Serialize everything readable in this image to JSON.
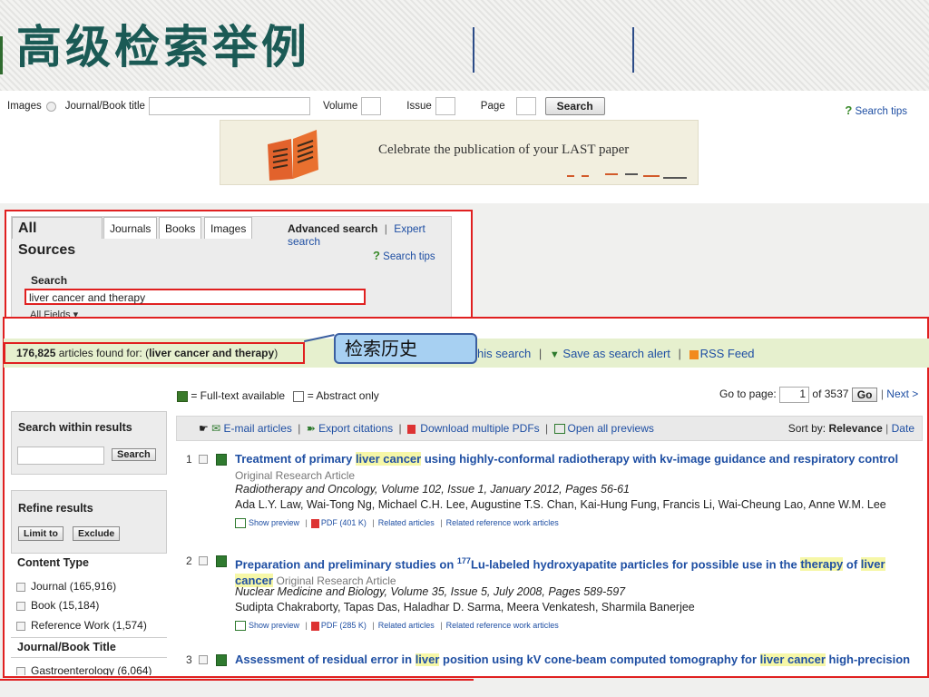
{
  "slide_title": "高级检索举例",
  "top_search": {
    "images_label": "Images",
    "journal_label": "Journal/Book title",
    "volume_label": "Volume",
    "issue_label": "Issue",
    "page_label": "Page",
    "search_button": "Search",
    "search_tips": "Search tips"
  },
  "banner": {
    "text": "Celebrate the publication of your LAST paper"
  },
  "advanced": {
    "tabs": [
      "All Sources",
      "Journals",
      "Books",
      "Images"
    ],
    "advanced_search": "Advanced search",
    "expert_search": "Expert search",
    "search_tips": "Search tips",
    "search_label": "Search",
    "query": "liver cancer and therapy",
    "field_select": "All Fields"
  },
  "results_header": {
    "count": "176,825",
    "found_text": " articles found for: (",
    "query": "liver cancer and therapy",
    "close_paren": ")",
    "history_callout": "检索历史",
    "edit_search": "his search",
    "save_alert": "Save as search alert",
    "rss": "RSS Feed"
  },
  "legend": {
    "full_text": "= Full-text available",
    "abstract": "= Abstract only"
  },
  "pagination": {
    "goto_label": "Go to page:",
    "current": "1",
    "of_text": "of 3537",
    "go": "Go",
    "next": "Next >"
  },
  "sidebar": {
    "search_within": "Search within results",
    "search_button": "Search",
    "refine": "Refine results",
    "limit_to": "Limit to",
    "exclude": "Exclude",
    "content_type": "Content Type",
    "content_items": [
      "Journal (165,916)",
      "Book (15,184)",
      "Reference Work (1,574)"
    ],
    "journal_title": "Journal/Book Title",
    "journal_items": [
      "Gastroenterology (6,064)"
    ]
  },
  "toolbar": {
    "email": "E-mail articles",
    "export": "Export citations",
    "download": "Download multiple PDFs",
    "open_previews": "Open all previews",
    "sort_label": "Sort by:",
    "sort_relevance": "Relevance",
    "sort_date": "Date"
  },
  "results": [
    {
      "num": "1",
      "title_pre": "Treatment of primary ",
      "title_hl1": "liver cancer",
      "title_post": " using highly-conformal radiotherapy with kv-image guidance and respiratory control",
      "type": "Original Research Article",
      "source": "Radiotherapy and Oncology, Volume 102, Issue 1, January 2012, Pages 56-61",
      "authors": "Ada L.Y. Law, Wai-Tong Ng, Michael C.H. Lee, Augustine T.S. Chan, Kai-Hung Fung, Francis Li, Wai-Cheung Lao, Anne W.M. Lee",
      "show_preview": "Show preview",
      "pdf": "PDF (401 K)",
      "related": "Related articles",
      "related_ref": "Related reference work articles"
    },
    {
      "num": "2",
      "title_pre": "Preparation and preliminary studies on ",
      "sup": "177",
      "title_mid": "Lu-labeled hydroxyapatite particles for possible use in the ",
      "title_hl1": "therapy",
      "title_mid2": " of ",
      "title_hl2": "liver cancer",
      "type": "Original Research Article",
      "source": "Nuclear Medicine and Biology, Volume 35, Issue 5, July 2008, Pages 589-597",
      "authors": "Sudipta Chakraborty, Tapas Das, Haladhar D. Sarma, Meera Venkatesh, Sharmila Banerjee",
      "show_preview": "Show preview",
      "pdf": "PDF (285 K)",
      "related": "Related articles",
      "related_ref": "Related reference work articles"
    },
    {
      "num": "3",
      "title_pre": "Assessment of residual error in ",
      "title_hl1": "liver",
      "title_mid": " position using kV cone-beam computed tomography for ",
      "title_hl2": "liver cancer",
      "title_post": " high-precision"
    }
  ]
}
